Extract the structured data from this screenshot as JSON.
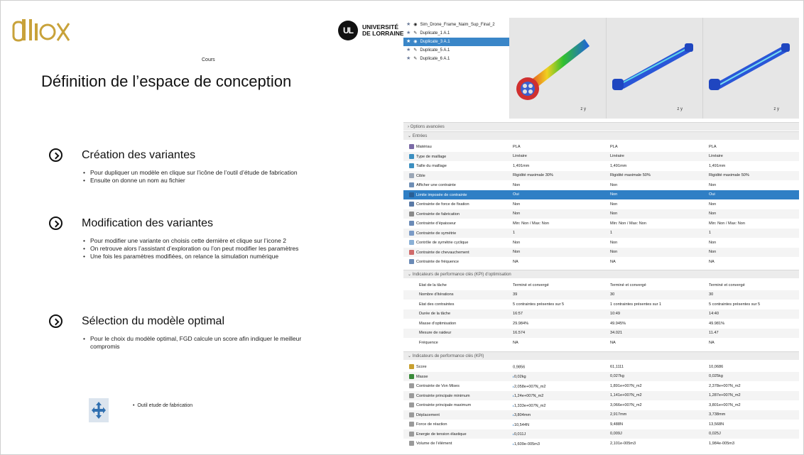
{
  "slide": {
    "logo_text": "Ditex",
    "university_mark": "UL",
    "university_name_line1": "UNIVERSITÉ",
    "university_name_line2": "DE LORRAINE",
    "subtitle": "Cours",
    "title": "Définition de l’espace de conception",
    "sections": [
      {
        "heading": "Création des variantes",
        "bullets": [
          "Pour dupliquer un modèle en clique sur l’icône de l’outil d’étude de fabrication",
          "Ensuite on donne un nom au fichier"
        ]
      },
      {
        "heading": "Modification des variantes",
        "bullets": [
          "Pour modifier une variante on choisis cette dernière et clique sur l’icone 2",
          "On retrouve alors l’assistant d’exploration ou l’on peut modifier les paramètres",
          "Une fois les paramètres modifiées, on relance la simulation numérique"
        ]
      },
      {
        "heading": "Sélection du modèle optimal",
        "bullets": [
          "Pour le choix du modèle optimal, FGD calcule un score afin indiquer le meilleur compromis"
        ]
      }
    ],
    "tool_label": "Outil etude de fabrication"
  },
  "app": {
    "tree": [
      {
        "label": "Sim_Drone_Frame_Naim_Sup_Final_2",
        "icon": "eye-icon",
        "selected": false
      },
      {
        "label": "Duplicate_1 A.1",
        "icon": "pencil-icon",
        "selected": false
      },
      {
        "label": "Duplicate_3 A.1",
        "icon": "eye-icon",
        "selected": true
      },
      {
        "label": "Duplicate_5 A.1",
        "icon": "pencil-icon",
        "selected": false
      },
      {
        "label": "Duplicate_6 A.1",
        "icon": "pencil-icon",
        "selected": false
      }
    ],
    "axes_label": "z  y",
    "bars": {
      "options": "›  Options avancées",
      "entries": "⌄  Entrées",
      "kpi_opt": "⌄  Indicateurs de performance clés (KPI) d’optimisation",
      "kpi": "⌄  Indicateurs de performance clés (KPI)"
    },
    "entries": [
      {
        "label": "Matériau",
        "v": [
          "PLA",
          "PLA",
          "PLA"
        ],
        "color": "#7a6aa6"
      },
      {
        "label": "Type de maillage",
        "v": [
          "Linéaire",
          "Linéaire",
          "Linéaire"
        ],
        "color": "#3c8fc0"
      },
      {
        "label": "Taille du maillage",
        "v": [
          "1,491mm",
          "1,491mm",
          "1,491mm"
        ],
        "color": "#3c8fc0"
      },
      {
        "label": "Cible",
        "v": [
          "Rigidité maximale 30%",
          "Rigidité maximale 50%",
          "Rigidité maximale 50%"
        ],
        "color": "#9aa6b6"
      },
      {
        "label": "Afficher une contrainte",
        "v": [
          "Non",
          "Non",
          "Non"
        ],
        "color": "#6f8fb6"
      },
      {
        "label": "Limite imposée de contrainte",
        "v": [
          "Oui",
          "Non",
          "Oui"
        ],
        "color": "#2a5f95"
      },
      {
        "label": "Contrainte de force de fixation",
        "v": [
          "Non",
          "Non",
          "Non"
        ],
        "color": "#5a7aa6"
      },
      {
        "label": "Contrainte de fabrication",
        "v": [
          "Non",
          "Non",
          "Non"
        ],
        "color": "#8a8a8a"
      },
      {
        "label": "Contrainte d’épaisseur",
        "v": [
          "Min: Non / Max: Non",
          "Min: Non / Max: Non",
          "Min: Non / Max: Non"
        ],
        "color": "#6a8ab6"
      },
      {
        "label": "Contrainte de symétrie",
        "v": [
          "1",
          "1",
          "1"
        ],
        "color": "#7a9ac6"
      },
      {
        "label": "Contrôle de symétrie cyclique",
        "v": [
          "Non",
          "Non",
          "Non"
        ],
        "color": "#8ab0d6"
      },
      {
        "label": "Contrainte de chevauchement",
        "v": [
          "Non",
          "Non",
          "Non"
        ],
        "color": "#d06a6a"
      },
      {
        "label": "Contrainte de fréquence",
        "v": [
          "NA",
          "NA",
          "NA"
        ],
        "color": "#6a8ab6"
      }
    ],
    "kpi_opt": [
      {
        "label": "Etat de la tâche",
        "v": [
          "Terminé et convergé",
          "Terminé et convergé",
          "Terminé et convergé"
        ]
      },
      {
        "label": "Nombre d’itérations",
        "v": [
          "39",
          "30",
          "30"
        ]
      },
      {
        "label": "Etat des contraintes",
        "v": [
          "5 contraintes présentes sur 5",
          "1 contraintes présentes sur 1",
          "5 contraintes présentes sur 5"
        ]
      },
      {
        "label": "Durée de la tâche",
        "v": [
          "16:57",
          "10:49",
          "14:40"
        ]
      },
      {
        "label": "Masse d’optimisation",
        "v": [
          "29.984%",
          "49.945%",
          "49.981%"
        ]
      },
      {
        "label": "Mesure de raideur",
        "v": [
          "16.574",
          "34.021",
          "11.47"
        ]
      },
      {
        "label": "Fréquence",
        "v": [
          "NA",
          "NA",
          "NA"
        ]
      }
    ],
    "kpi": [
      {
        "label": "Score",
        "v": [
          "70,9856",
          "61,1111",
          "10,0686"
        ],
        "color": "#c8a030"
      },
      {
        "label": "Masse",
        "v": [
          "0,02kg",
          "0,027kg",
          "0,025kg"
        ],
        "color": "#3a8a3a"
      },
      {
        "label": "Contrainte de Von Mises",
        "v": [
          "2,058e+007N_m2",
          "1,891e+007N_m2",
          "2,378e+007N_m2"
        ],
        "color": "#9a9a9a"
      },
      {
        "label": "Contrainte principale minimum",
        "v": [
          "1,24e+007N_m2",
          "1,141e+007N_m2",
          "1,287e+007N_m2"
        ],
        "color": "#9a9a9a"
      },
      {
        "label": "Contrainte principale maximum",
        "v": [
          "1,333e+007N_m2",
          "3,066e+007N_m2",
          "3,801e+007N_m2"
        ],
        "color": "#9a9a9a"
      },
      {
        "label": "Déplacement",
        "v": [
          "3,804mm",
          "2,917mm",
          "3,738mm"
        ],
        "color": "#9a9a9a"
      },
      {
        "label": "Force de réaction",
        "v": [
          "10,544N",
          "9,488N",
          "13,568N"
        ],
        "color": "#9a9a9a"
      },
      {
        "label": "Energie de tension élastique",
        "v": [
          "0,011J",
          "0,009J",
          "0,025J"
        ],
        "color": "#9a9a9a"
      },
      {
        "label": "Volume de l’élément",
        "v": [
          "1,609e-005m3",
          "2,101e-005m3",
          "1,984e-005m3"
        ],
        "color": "#9a9a9a"
      }
    ]
  }
}
